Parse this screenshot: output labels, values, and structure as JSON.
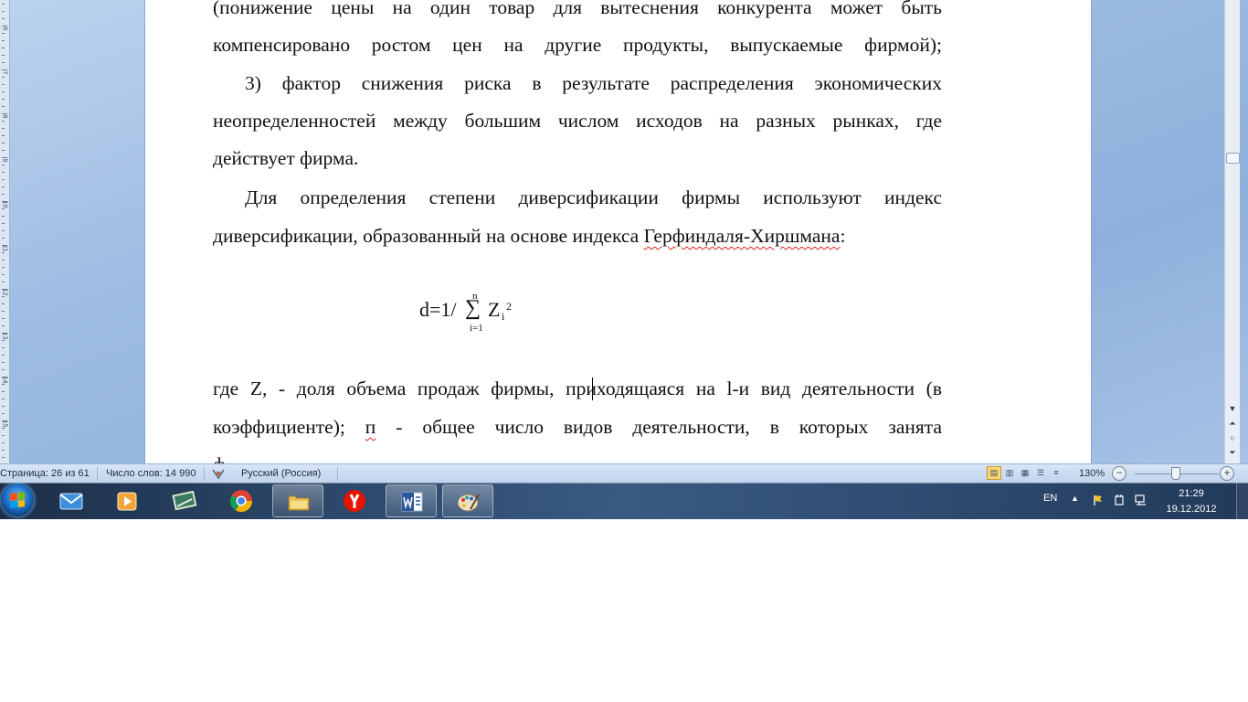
{
  "document": {
    "line1": "(понижение цены на один товар для вытеснения конкурента может быть",
    "line2": "компенсировано ростом цен на другие продукты, выпускаемые фирмой);",
    "line3": "3) фактор снижения риска в результате распределения экономических",
    "line4": "неопределенностей между большим числом исходов на разных рынках, где",
    "line5": "действует фирма.",
    "line6": "Для определения степени диверсификации фирмы используют индекс",
    "line7_start": "диверсификации, образованный на основе индекса ",
    "line7_link": "Герфиндаля-Хиршмана",
    "line7_end": ":",
    "formula": {
      "main": "d=1/",
      "sum": "∑",
      "upper": "n",
      "lower": "i=1",
      "var": "Z",
      "sub": "i",
      "sup": "2"
    },
    "line8": "где Z, - доля объема продаж фирмы, приходящаяся на l-и вид деятельности (в",
    "line9_start": "коэффициенте); ",
    "line9_word": "п",
    "line9_end": " - общее число видов деятельности, в которых занята",
    "line10": "ф"
  },
  "ruler": {
    "numbers": [
      "6",
      "7",
      "8",
      "9",
      "10",
      "11",
      "12",
      "13",
      "14",
      "15"
    ]
  },
  "scrollbar": {
    "down_icon": "arrow-down-icon",
    "prev_icon": "prev-page-icon",
    "browse_icon": "select-browse-object-icon",
    "next_icon": "next-page-icon"
  },
  "statusbar": {
    "page": "Страница: 26 из 61",
    "words": "Число слов: 14 990",
    "language": "Русский (Россия)",
    "zoom": "130%",
    "zoom_minus": "−",
    "zoom_plus": "+"
  },
  "taskbar": {
    "lang": "EN",
    "time": "21:29",
    "date": "19.12.2012",
    "tray_up": "▲",
    "apps": [
      "start-orb",
      "mail-icon",
      "media-player-icon",
      "tablet-icon",
      "chrome-icon",
      "explorer-folder-icon",
      "yandex-icon",
      "word-icon",
      "paint-icon"
    ]
  },
  "colors": {
    "accent": "#2b579a",
    "spell_underline": "#dd2222",
    "taskbar": "#2b4668"
  }
}
